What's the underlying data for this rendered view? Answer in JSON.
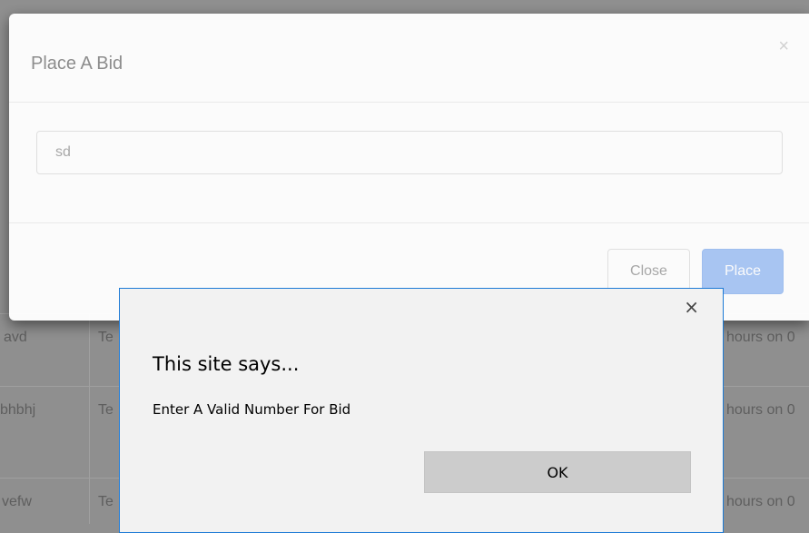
{
  "background_table": {
    "rows": [
      {
        "name": "avd",
        "type": "Te",
        "time": "hours on 0"
      },
      {
        "name": "bhbhj",
        "type": "Te",
        "time": "hours on 0"
      },
      {
        "name": "vefw",
        "type": "Te",
        "time": "hours on 0"
      }
    ]
  },
  "modal": {
    "title": "Place A Bid",
    "close_icon": "×",
    "bid_input": {
      "value": "sd",
      "placeholder": ""
    },
    "close_button_label": "Close",
    "place_button_label": "Place",
    "colors": {
      "primary": "#a9c7f6"
    }
  },
  "alert": {
    "close_icon": "×",
    "title": "This site says...",
    "message": "Enter A Valid Number For Bid",
    "ok_label": "OK",
    "colors": {
      "border": "#1c7ad6"
    }
  }
}
